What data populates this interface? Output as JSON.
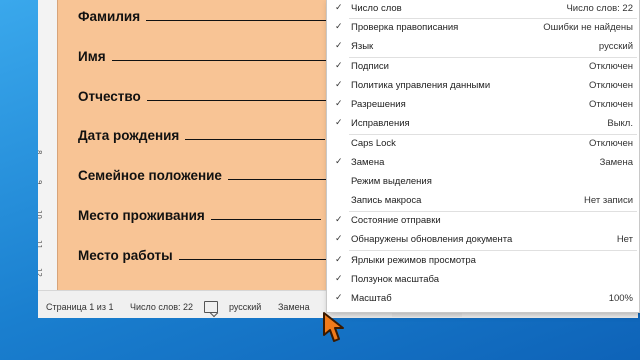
{
  "form": {
    "fields": [
      {
        "label": "Фамилия"
      },
      {
        "label": "Имя"
      },
      {
        "label": "Отчество"
      },
      {
        "label": "Дата рождения"
      },
      {
        "label": "Семейное положение"
      },
      {
        "label": "Место проживания"
      },
      {
        "label": "Место работы"
      }
    ],
    "ruler_numbers": [
      "8",
      "9",
      "10",
      "11",
      "12"
    ]
  },
  "status_bar": {
    "page": "Страница 1 из 1",
    "word_count": "Число слов: 22",
    "language": "русский",
    "track_changes": "Замена"
  },
  "context_menu": {
    "items": [
      {
        "label": "Число слов",
        "value": "Число слов: 22",
        "checked": true
      },
      {
        "label": "Проверка правописания",
        "value": "Ошибки не найдены",
        "checked": true
      },
      {
        "label": "Язык",
        "value": "русский",
        "checked": true
      },
      {
        "label": "Подписи",
        "value": "Отключен",
        "checked": true
      },
      {
        "label": "Политика управления данными",
        "value": "Отключен",
        "checked": true
      },
      {
        "label": "Разрешения",
        "value": "Отключен",
        "checked": true
      },
      {
        "label": "Исправления",
        "value": "Выкл.",
        "checked": true
      },
      {
        "label": "Caps Lock",
        "value": "Отключен",
        "checked": false
      },
      {
        "label": "Замена",
        "value": "Замена",
        "checked": true
      },
      {
        "label": "Режим выделения",
        "value": "",
        "checked": false
      },
      {
        "label": "Запись макроса",
        "value": "Нет записи",
        "checked": false
      },
      {
        "label": "Состояние отправки",
        "value": "",
        "checked": true
      },
      {
        "label": "Обнаружены обновления документа",
        "value": "Нет",
        "checked": true
      },
      {
        "label": "Ярлыки режимов просмотра",
        "value": "",
        "checked": true
      },
      {
        "label": "Ползунок масштаба",
        "value": "",
        "checked": true
      },
      {
        "label": "Масштаб",
        "value": "100%",
        "checked": true
      }
    ]
  },
  "colors": {
    "page_fill": "#f8c495",
    "desktop": "#1a7fcf",
    "cursor": "#f07a1a"
  },
  "icons": {
    "check": "checkmark-icon",
    "proofing": "proofing-book-icon",
    "cursor": "mouse-pointer-icon"
  }
}
